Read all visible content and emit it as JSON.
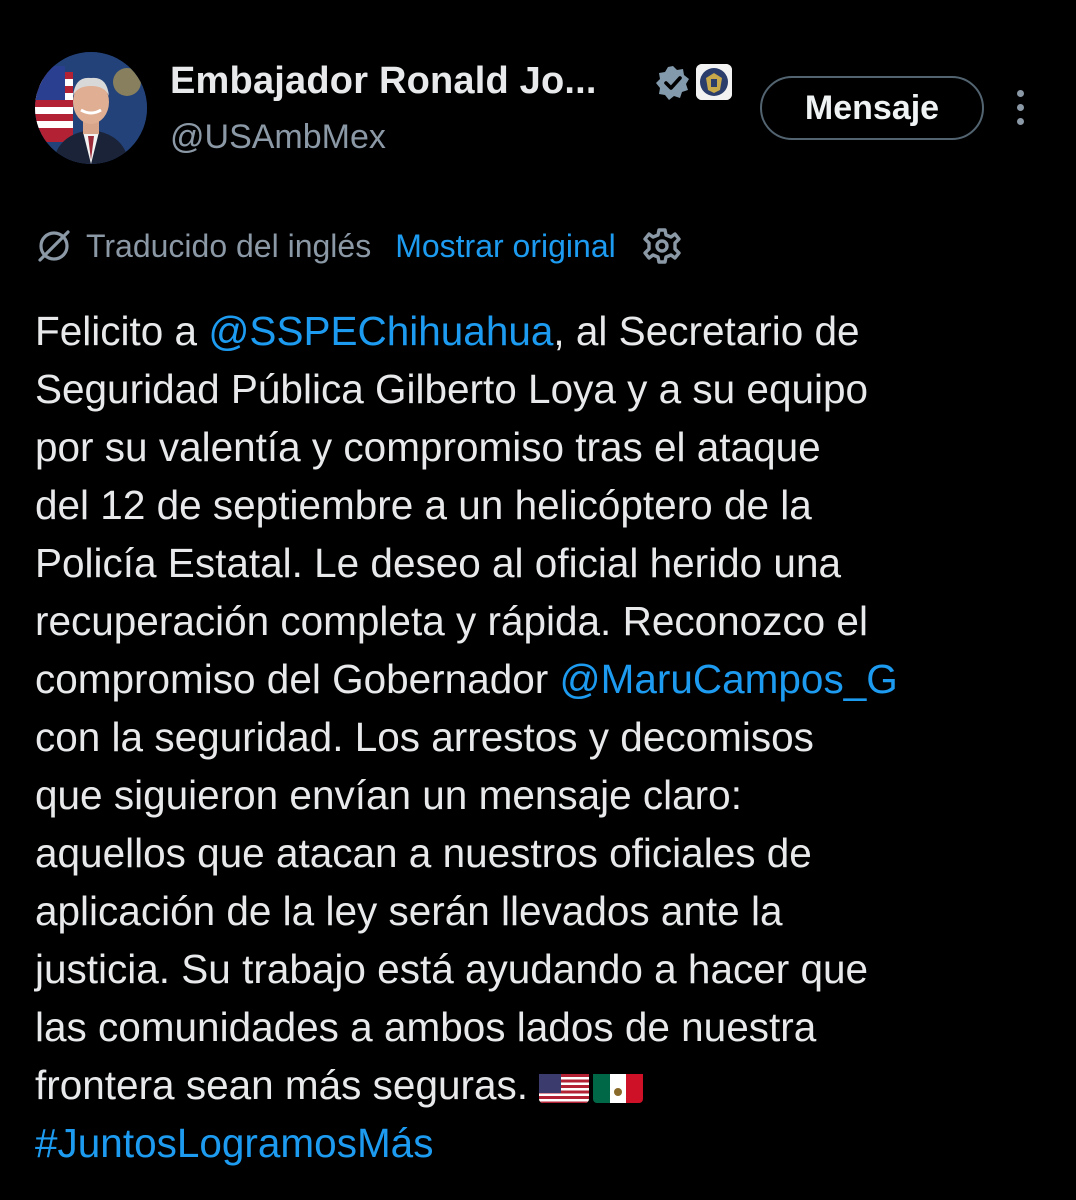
{
  "profile": {
    "name": "Embajador Ronald Jo...",
    "handle": "@USAmbMex",
    "message_button": "Mensaje"
  },
  "translation": {
    "label": "Traducido del inglés",
    "show_original": "Mostrar original"
  },
  "tweet": {
    "lines": [
      {
        "pre": "Felicito a ",
        "link": "@SSPEChihuahua",
        "post": ", al Secretario de"
      },
      {
        "text": "Seguridad Pública Gilberto Loya y a su equipo"
      },
      {
        "text": "por su valentía y compromiso tras el ataque"
      },
      {
        "text": "del 12 de septiembre a un helicóptero de la"
      },
      {
        "text": "Policía Estatal. Le deseo al oficial herido una"
      },
      {
        "text": "recuperación completa y rápida. Reconozco el"
      },
      {
        "pre": "compromiso del Gobernador ",
        "link": "@MaruCampos_G",
        "post": ""
      },
      {
        "text": "con la seguridad. Los arrestos y decomisos"
      },
      {
        "text": "que siguieron envían un mensaje claro:"
      },
      {
        "text": "aquellos que atacan a nuestros oficiales de"
      },
      {
        "text": "aplicación de la ley serán llevados ante la"
      },
      {
        "text": "justicia. Su trabajo está ayudando a hacer que"
      },
      {
        "text": "las comunidades a ambos lados de nuestra"
      },
      {
        "text": "frontera sean más seguras. "
      },
      {
        "hashtag": "#JuntosLogramosMás"
      }
    ],
    "flags": [
      "us-flag",
      "mexico-flag"
    ]
  },
  "colors": {
    "background": "#000000",
    "text": "#e7e9ea",
    "secondary": "#8b98a5",
    "link": "#1d9bf0"
  },
  "icons": [
    "verified-badge-icon",
    "government-affiliation-icon",
    "more-options-icon",
    "translate-icon",
    "gear-icon"
  ]
}
